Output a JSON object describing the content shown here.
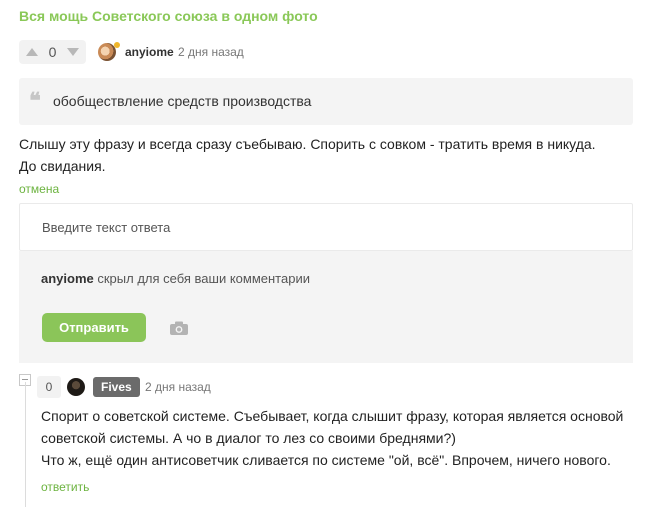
{
  "post": {
    "title": "Вся мощь Советского союза в одном фото"
  },
  "comment": {
    "vote_count": "0",
    "author": "anyiome",
    "time": "2 дня назад",
    "quote": "обобществление средств производства",
    "text_line1": "Слышу эту фразу и всегда сразу съебываю. Спорить с совком - тратить время в никуда.",
    "text_line2": "До свидания.",
    "cancel_label": "отмена"
  },
  "reply_form": {
    "placeholder": "Введите текст ответа",
    "hidden_user": "anyiome",
    "hidden_notice": " скрыл для себя ваши комментарии",
    "send_label": "Отправить"
  },
  "reply": {
    "vote_count": "0",
    "author": "Fives",
    "time": "2 дня назад",
    "text_line1": "Спорит о советской системе. Съебывает, когда слышит фразу, которая является основой",
    "text_line2": "советской системы. А чо в диалог то лез со своими бреднями?)",
    "text_line3": "Что ж, ещё один антисоветчик сливается по системе \"ой, всё\". Впрочем, ничего нового.",
    "reply_label": "ответить"
  },
  "icons": {
    "upvote": "arrow-up-icon",
    "downvote": "arrow-down-icon",
    "quote": "quote-icon",
    "camera": "camera-icon",
    "collapse": "collapse-icon"
  },
  "colors": {
    "accent_green": "#8ac858",
    "link_green": "#6cb33f",
    "panel_gray": "#f4f4f4",
    "author_badge": "#6b6b6b"
  }
}
